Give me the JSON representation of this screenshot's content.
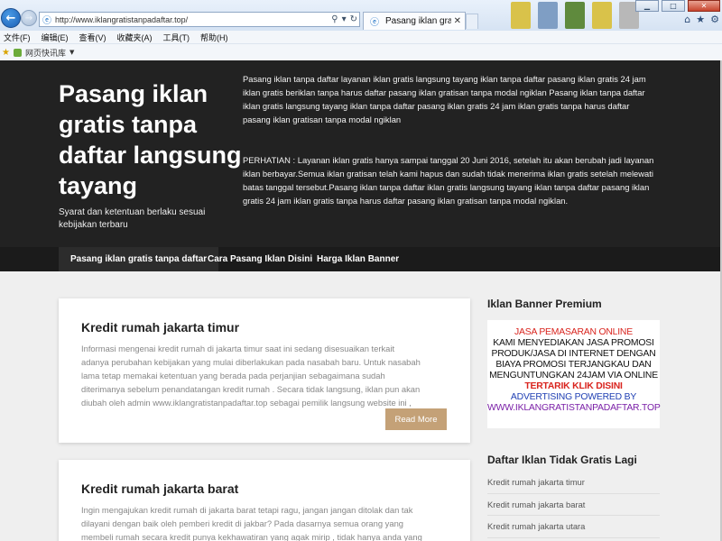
{
  "browser": {
    "url": "http://www.iklangratistanpadaftar.top/",
    "tab_title": "Pasang iklan gratis tanp...",
    "menu": [
      "文件(F)",
      "编辑(E)",
      "查看(V)",
      "收藏夹(A)",
      "工具(T)",
      "帮助(H)"
    ],
    "favorites_label": "网页快讯库"
  },
  "site": {
    "title": "Pasang iklan gratis tanpa daftar langsung tayang",
    "description": "Syarat dan ketentuan berlaku sesuai kebijakan terbaru",
    "intro_1": "Pasang iklan tanpa daftar layanan iklan gratis langsung tayang iklan tanpa daftar pasang iklan gratis 24 jam iklan gratis beriklan tanpa harus daftar pasang iklan gratisan tanpa modal ngiklan Pasang iklan tanpa daftar iklan gratis langsung tayang iklan tanpa daftar pasang iklan gratis 24 jam iklan gratis tanpa harus daftar pasang iklan gratisan tanpa modal ngiklan",
    "intro_2": "PERHATIAN : Layanan iklan gratis hanya sampai tanggal 20 Juni 2016, setelah itu akan berubah jadi layanan iklan berbayar.Semua iklan gratisan telah kami hapus dan sudah tidak menerima iklan gratis setelah melewati batas tanggal tersebut.Pasang iklan tanpa daftar iklan gratis langsung tayang iklan tanpa daftar pasang iklan gratis 24 jam iklan gratis tanpa harus daftar pasang iklan gratisan tanpa modal ngiklan."
  },
  "nav": [
    "Pasang iklan gratis tanpa daftar",
    "Cara Pasang Iklan Disini",
    "Harga Iklan Banner"
  ],
  "posts": [
    {
      "title": "Kredit rumah jakarta timur",
      "excerpt": "Informasi mengenai kredit rumah di jakarta timur saat ini sedang disesuaikan terkait adanya perubahan kebijakan yang mulai diberlakukan pada nasabah baru. Untuk nasabah lama tetap memakai ketentuan yang berada pada perjanjian sebagaimana sudah diterimanya sebelum penandatangan kredit rumah . Secara tidak langsung, iklan pun akan diubah oleh admin www.iklangratistanpadaftar.top sebagai pemilik langsung website ini ,",
      "button": "Read More"
    },
    {
      "title": "Kredit rumah jakarta barat",
      "excerpt": "Ingin mengajukan kredit rumah di jakarta barat tetapi ragu, jangan jangan ditolak dan tak dilayani dengan baik oleh pemberi kredit di jakbar? Pada dasarnya semua orang yang membeli rumah secara kredit punya kekhawatiran yang agak mirip , tidak hanya anda yang merasa pengajuannya tidak"
    }
  ],
  "sidebar": {
    "banner_widget_title": "Iklan Banner Premium",
    "banner_lines": [
      "JASA PEMASARAN ONLINE",
      "KAMI MENYEDIAKAN JASA  PROMOSI",
      "PRODUK/JASA DI INTERNET DENGAN",
      "BIAYA  PROMOSI  TERJANGKAU  DAN",
      "MENGUNTUNGKAN 24JAM VIA ONLINE",
      "TERTARIK KLIK DISINI",
      "ADVERTISING POWERED BY",
      "WWW.IKLANGRATISTANPADAFTAR.TOP"
    ],
    "list_widget_title": "Daftar Iklan Tidak Gratis Lagi",
    "links": [
      "Kredit rumah jakarta timur",
      "Kredit rumah jakarta barat",
      "Kredit rumah jakarta utara"
    ]
  },
  "colors": {
    "header_bg": "#222222",
    "nav_bg": "#1b1b1b",
    "read_more_bg": "#c4a177",
    "banner_red": "#d9241e",
    "banner_blue": "#1f3fb3",
    "banner_purple": "#7a1fa7"
  }
}
